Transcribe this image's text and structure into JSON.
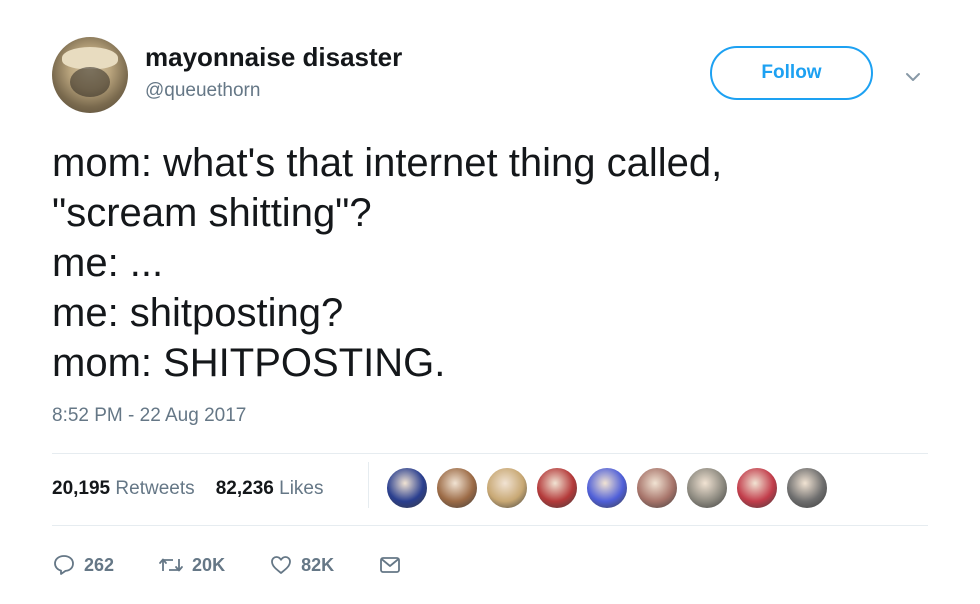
{
  "user": {
    "display_name": "mayonnaise disaster",
    "handle": "@queuethorn",
    "avatar_icon": "profile-avatar"
  },
  "follow_button": {
    "label": "Follow",
    "color": "#1da1f2"
  },
  "menu": {
    "icon": "chevron-down-icon"
  },
  "tweet": {
    "lines": [
      "mom: what's that internet thing called,",
      "\"scream shitting\"?",
      "me: ...",
      "me: shitposting?",
      "mom: SHITPOSTING."
    ],
    "timestamp": "8:52 PM - 22 Aug 2017"
  },
  "stats": {
    "retweets_count": "20,195",
    "retweets_label": "Retweets",
    "likes_count": "82,236",
    "likes_label": "Likes"
  },
  "likers": [
    {
      "color": "#2a3f8f"
    },
    {
      "color": "#9c6b46"
    },
    {
      "color": "#c8a874"
    },
    {
      "color": "#b43a3a"
    },
    {
      "color": "#4f5fd8"
    },
    {
      "color": "#a7746a"
    },
    {
      "color": "#8d8a80"
    },
    {
      "color": "#c23d4b"
    },
    {
      "color": "#6e6e6e"
    }
  ],
  "actions": {
    "reply_count": "262",
    "retweet_count": "20K",
    "like_count": "82K",
    "icons": [
      "reply-icon",
      "retweet-icon",
      "heart-icon",
      "message-icon"
    ]
  }
}
